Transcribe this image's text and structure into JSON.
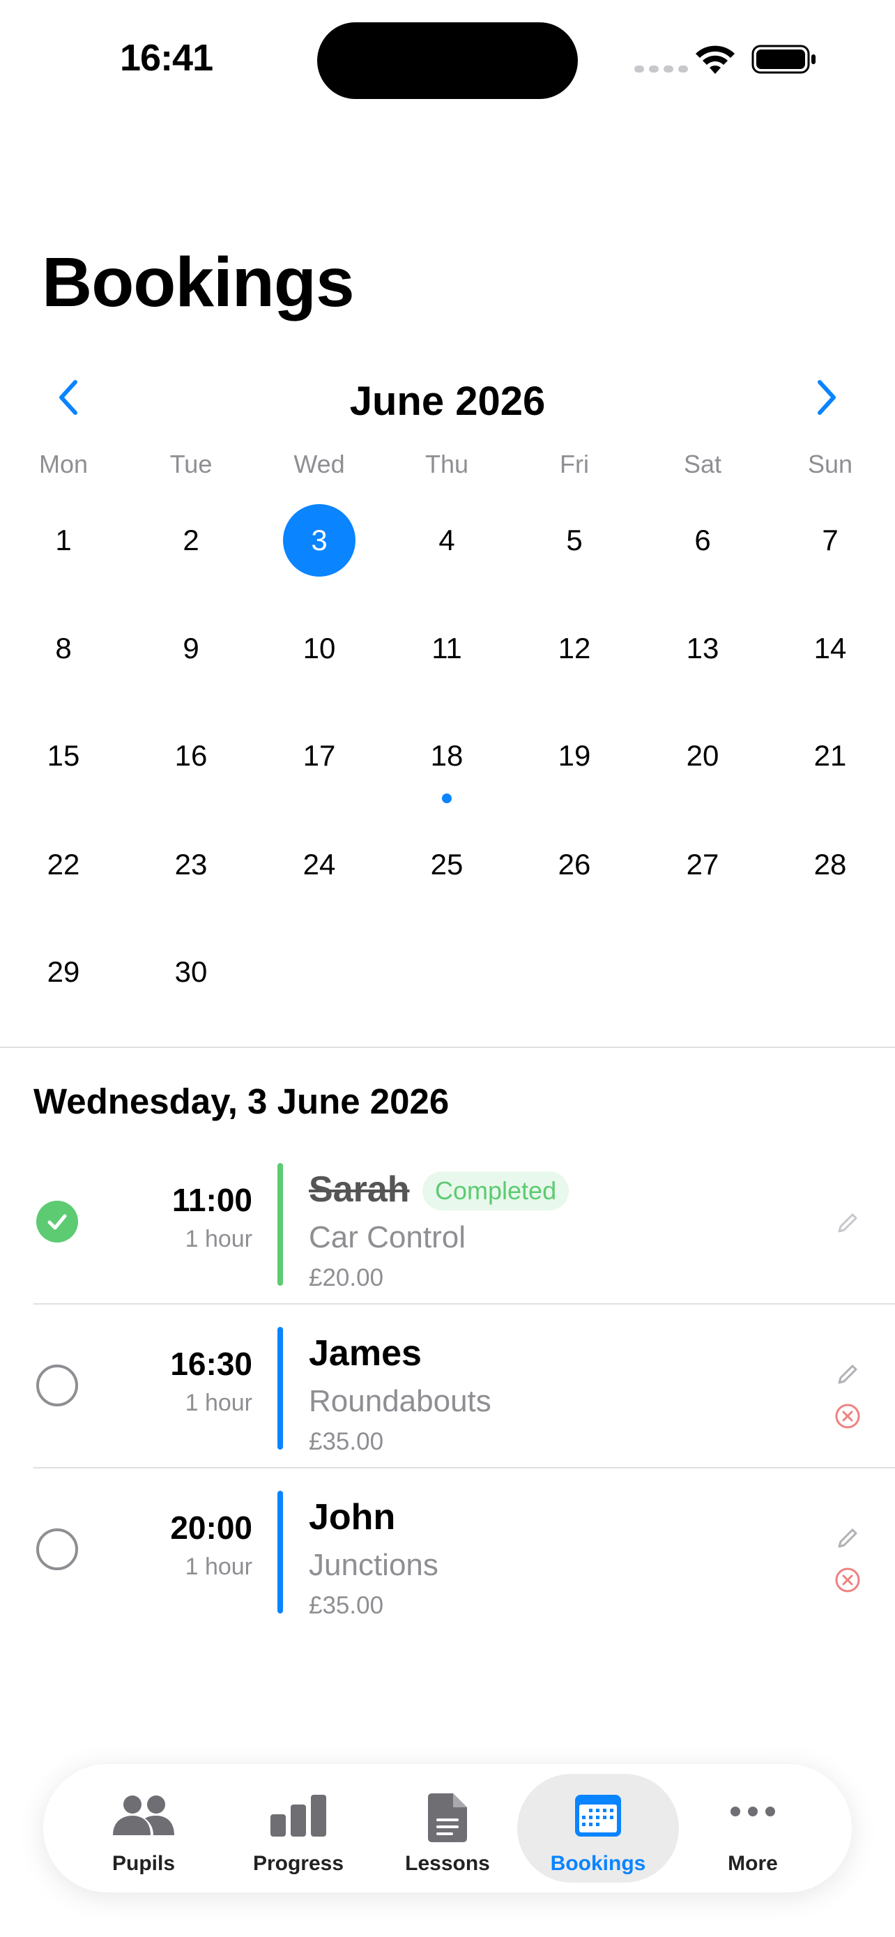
{
  "status_bar": {
    "time": "16:41"
  },
  "page": {
    "title": "Bookings"
  },
  "calendar": {
    "month_label": "June 2026",
    "weekdays": [
      "Mon",
      "Tue",
      "Wed",
      "Thu",
      "Fri",
      "Sat",
      "Sun"
    ],
    "weeks": [
      [
        "1",
        "2",
        "3",
        "4",
        "5",
        "6",
        "7"
      ],
      [
        "8",
        "9",
        "10",
        "11",
        "12",
        "13",
        "14"
      ],
      [
        "15",
        "16",
        "17",
        "18",
        "19",
        "20",
        "21"
      ],
      [
        "22",
        "23",
        "24",
        "25",
        "26",
        "27",
        "28"
      ],
      [
        "29",
        "30",
        "",
        "",
        "",
        "",
        ""
      ]
    ],
    "selected_day": "3",
    "days_with_bookings": [
      "18"
    ]
  },
  "day_heading": "Wednesday, 3 June 2026",
  "bookings": [
    {
      "time": "11:00",
      "duration": "1 hour",
      "pupil": "Sarah",
      "lesson": "Car Control",
      "price": "£20.00",
      "badge": "Completed"
    },
    {
      "time": "16:30",
      "duration": "1 hour",
      "pupil": "James",
      "lesson": "Roundabouts",
      "price": "£35.00"
    },
    {
      "time": "20:00",
      "duration": "1 hour",
      "pupil": "John",
      "lesson": "Junctions",
      "price": "£35.00"
    }
  ],
  "tab_bar": {
    "pupils": "Pupils",
    "progress": "Progress",
    "lessons": "Lessons",
    "bookings": "Bookings",
    "more": "More"
  },
  "colors": {
    "accent": "#0a84ff",
    "completed": "#5ccb72",
    "cancel": "#f08080",
    "secondary_text": "#8e8e93"
  }
}
